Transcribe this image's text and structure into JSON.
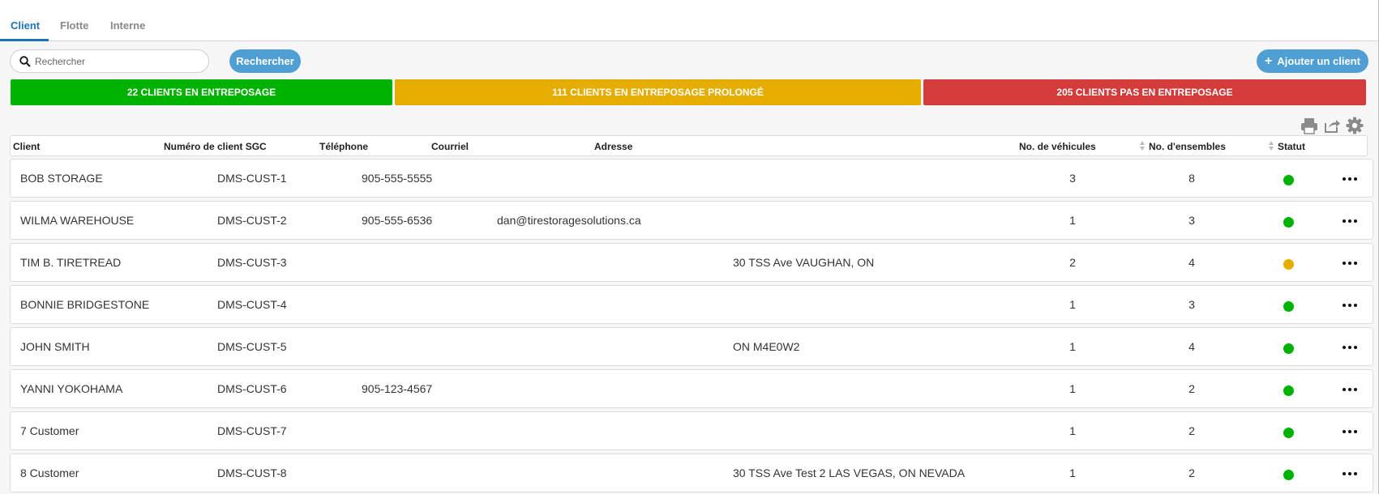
{
  "tabs": [
    {
      "label": "Client",
      "active": true
    },
    {
      "label": "Flotte",
      "active": false
    },
    {
      "label": "Interne",
      "active": false
    }
  ],
  "search": {
    "placeholder": "Rechercher",
    "button_label": "Rechercher"
  },
  "add_button_label": "Ajouter un client",
  "status_bars": {
    "green": "22 CLIENTS EN ENTREPOSAGE",
    "yellow": "111 CLIENTS EN ENTREPOSAGE PROLONGÉ",
    "red": "205 CLIENTS PAS EN ENTREPOSAGE"
  },
  "colors": {
    "accent": "#4f9fd5",
    "green": "#00b200",
    "yellow": "#e5ad00",
    "red": "#d43c3c"
  },
  "toolbar_icons": [
    "print-icon",
    "export-icon",
    "gear-icon"
  ],
  "columns": [
    "Client",
    "Numéro de client SGC",
    "Téléphone",
    "Courriel",
    "Adresse",
    "No. de véhicules",
    "No. d'ensembles",
    "Statut"
  ],
  "rows": [
    {
      "client": "BOB STORAGE",
      "number": "DMS-CUST-1",
      "phone": "905-555-5555",
      "email": "",
      "address": "",
      "vehicles": "3",
      "sets": "8",
      "status": "green"
    },
    {
      "client": "WILMA WAREHOUSE",
      "number": "DMS-CUST-2",
      "phone": "905-555-6536",
      "email": "dan@tirestoragesolutions.ca",
      "address": "",
      "vehicles": "1",
      "sets": "3",
      "status": "green"
    },
    {
      "client": "TIM B. TIRETREAD",
      "number": "DMS-CUST-3",
      "phone": "",
      "email": "",
      "address": "30 TSS Ave VAUGHAN, ON",
      "vehicles": "2",
      "sets": "4",
      "status": "yellow"
    },
    {
      "client": "BONNIE BRIDGESTONE",
      "number": "DMS-CUST-4",
      "phone": "",
      "email": "",
      "address": "",
      "vehicles": "1",
      "sets": "3",
      "status": "green"
    },
    {
      "client": "JOHN SMITH",
      "number": "DMS-CUST-5",
      "phone": "",
      "email": "",
      "address": "ON M4E0W2",
      "vehicles": "1",
      "sets": "4",
      "status": "green"
    },
    {
      "client": "YANNI YOKOHAMA",
      "number": "DMS-CUST-6",
      "phone": "905-123-4567",
      "email": "",
      "address": "",
      "vehicles": "1",
      "sets": "2",
      "status": "green"
    },
    {
      "client": "7 Customer",
      "number": "DMS-CUST-7",
      "phone": "",
      "email": "",
      "address": "",
      "vehicles": "1",
      "sets": "2",
      "status": "green"
    },
    {
      "client": "8 Customer",
      "number": "DMS-CUST-8",
      "phone": "",
      "email": "",
      "address": "30 TSS Ave Test 2 LAS VEGAS, ON NEVADA",
      "vehicles": "1",
      "sets": "2",
      "status": "green"
    }
  ]
}
